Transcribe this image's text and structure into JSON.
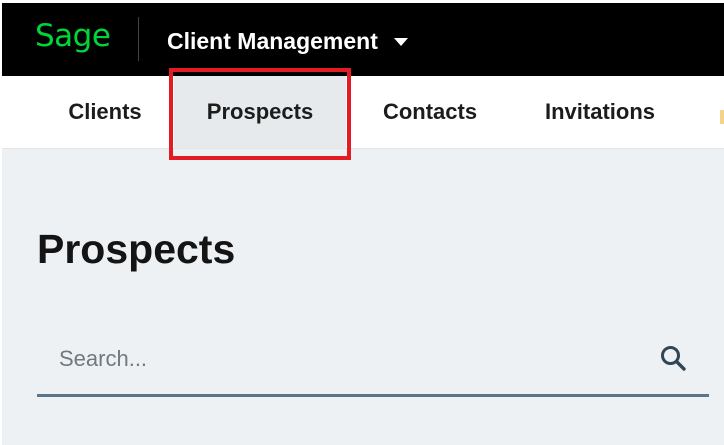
{
  "topbar": {
    "logo_text": "Sage",
    "app_title": "Client Management"
  },
  "nav": {
    "tabs": [
      {
        "label": "Clients",
        "active": false
      },
      {
        "label": "Prospects",
        "active": true
      },
      {
        "label": "Contacts",
        "active": false
      },
      {
        "label": "Invitations",
        "active": false
      }
    ]
  },
  "main": {
    "page_title": "Prospects",
    "search": {
      "placeholder": "Search...",
      "value": ""
    }
  },
  "colors": {
    "brand_green": "#00d639",
    "topbar_bg": "#000000",
    "highlight": "#e31b23",
    "page_bg": "#eef1f3",
    "search_underline": "#5b7488"
  },
  "icons": {
    "app_switcher": "caret-down-icon",
    "search": "search-icon"
  }
}
